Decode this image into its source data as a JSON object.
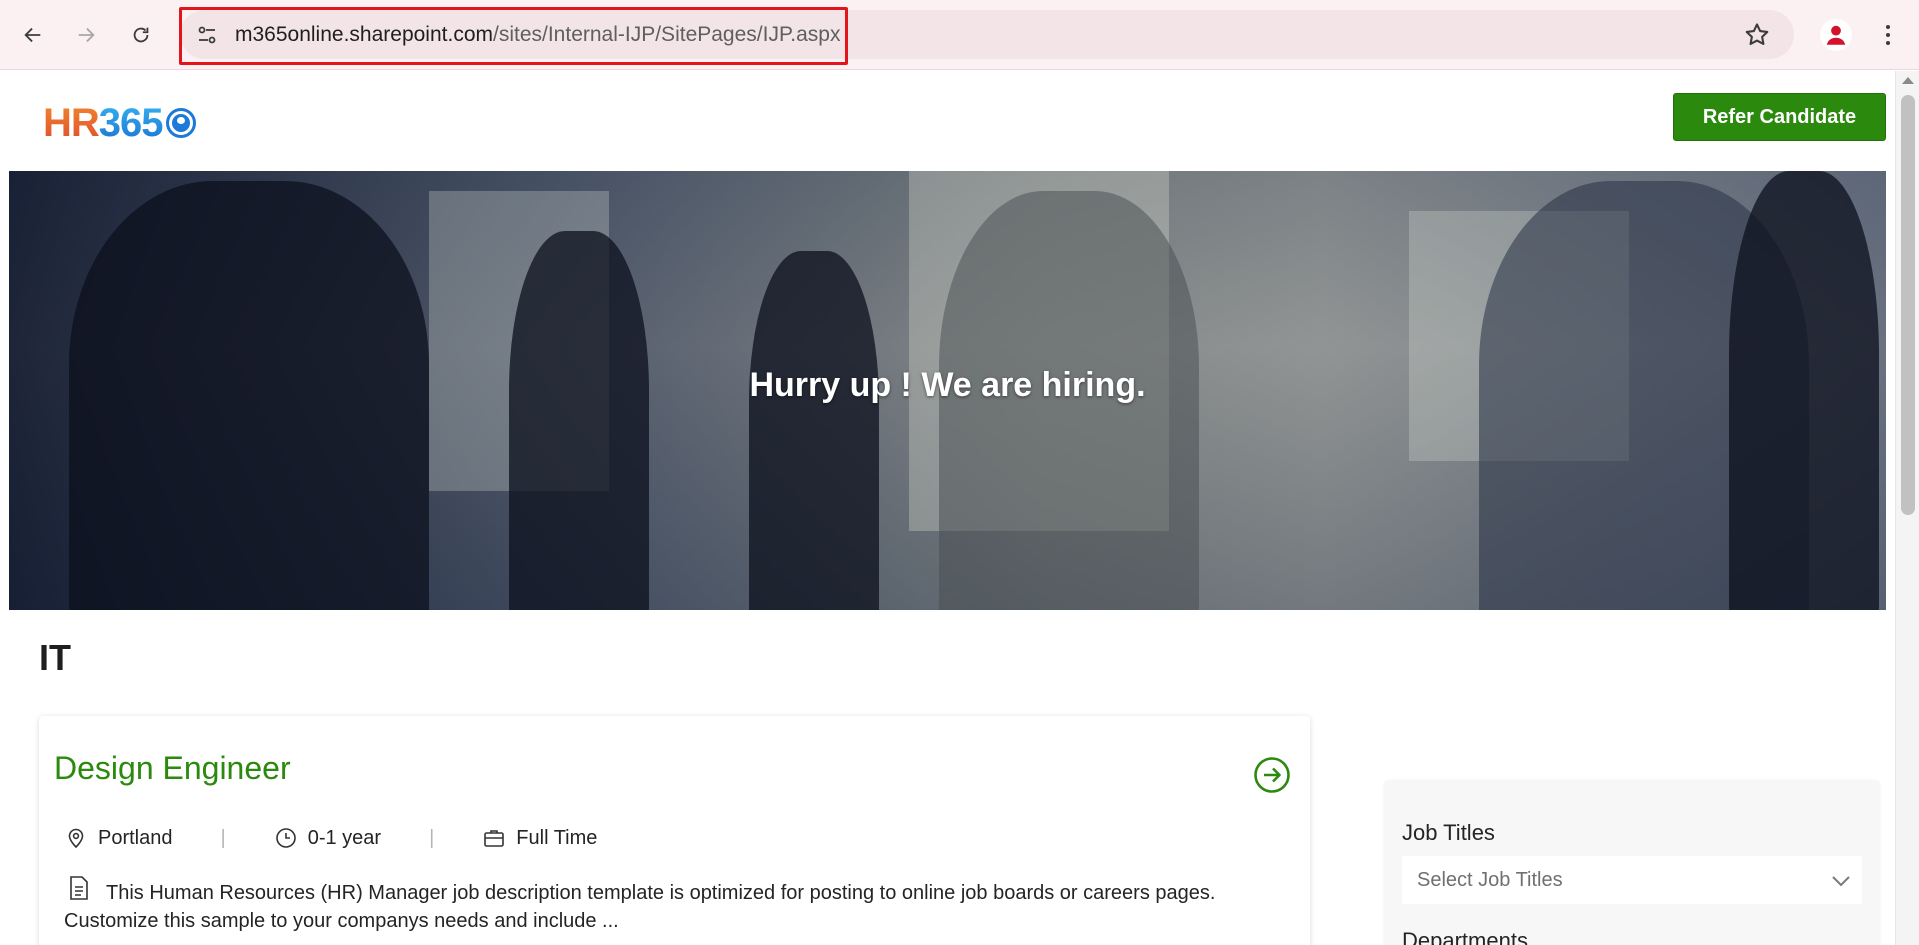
{
  "browser": {
    "url_host": "m365online.sharepoint.com",
    "url_path": "/sites/Internal-IJP/SitePages/IJP.aspx",
    "icons": [
      "back-icon",
      "forward-icon",
      "reload-icon",
      "site-info-icon",
      "bookmark-star-icon",
      "profile-icon",
      "more-menu-icon"
    ]
  },
  "header": {
    "logo_hr": "HR",
    "logo_num": "365",
    "refer_button": "Refer Candidate"
  },
  "hero": {
    "title": "Hurry up ! We are hiring."
  },
  "department": {
    "title": "IT"
  },
  "job": {
    "title": "Design Engineer",
    "location": "Portland",
    "experience": "0-1 year",
    "employment_type": "Full Time",
    "separator": "|",
    "description": "This Human Resources (HR) Manager job description template is optimized for posting to online job boards or careers pages. Customize this sample to your companys needs and include ..."
  },
  "filters": {
    "job_titles_label": "Job Titles",
    "job_titles_placeholder": "Select Job Titles",
    "departments_label": "Departments"
  },
  "colors": {
    "accent_green": "#2b8a0e",
    "url_highlight": "#e3151b",
    "profile_red": "#d3132c"
  }
}
